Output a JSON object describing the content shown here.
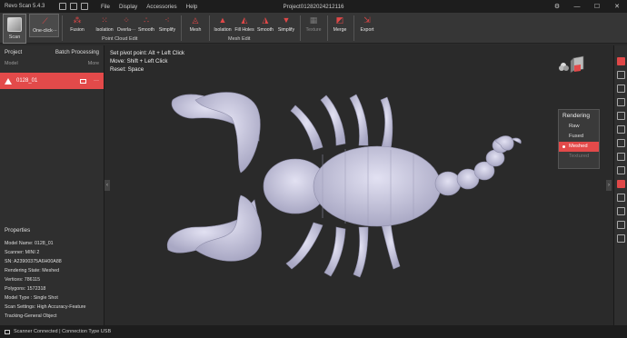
{
  "app": {
    "name": "Revo Scan 5.4.3",
    "project_title": "Project01282024212116"
  },
  "menu": [
    "File",
    "Display",
    "Accessories",
    "Help"
  ],
  "toolbar": {
    "scan_label": "Scan",
    "oneclick_label": "One-click···",
    "pc_tools": [
      "Fusion",
      "Isolation",
      "Overla···",
      "Smooth",
      "Simplify"
    ],
    "pc_group": "Point Cloud Edit",
    "mesh_tools": [
      "Mesh",
      "Isolation",
      "Fill Holes",
      "Smooth",
      "Simplify"
    ],
    "mesh_group": "Mesh Edit",
    "texture_label": "Texture",
    "merge_label": "Merge",
    "export_label": "Export"
  },
  "project_panel": {
    "title": "Project",
    "batch": "Batch Processing",
    "col_model": "Model",
    "col_more": "More",
    "model_name": "0128_01",
    "more_dots": "···"
  },
  "properties": {
    "title": "Properties",
    "rows": [
      "Model Name:  0128_01",
      "Scanner:  MINI 2",
      "SN:  A23900375A6H00A88",
      "Rendering State:  Meshed",
      "Vertices:  786115",
      "Polygons:  1572318",
      "Model Type :  Single Shot",
      "Scan Settings:  High Accuracy-Feature",
      "Tracking-General Object"
    ]
  },
  "hints": [
    "Set pivot point: Alt + Left Click",
    "Move: Shift + Left Click",
    "Reset: Space"
  ],
  "rendering": {
    "title": "Rendering",
    "options": [
      "Raw",
      "Fused",
      "Meshed",
      "Textured"
    ],
    "selected": "Meshed"
  },
  "status": {
    "text": "Scanner Connected | Connection Type USB"
  },
  "colors": {
    "accent": "#e34a4a",
    "model": "#c9c8e0"
  }
}
